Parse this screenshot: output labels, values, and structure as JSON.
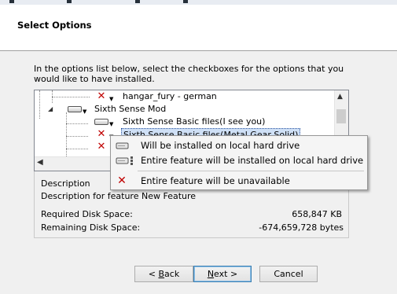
{
  "header": {
    "title": "Select Options"
  },
  "instructions": "In the options list below, select the checkboxes for the options that you would like to have installed.",
  "tree": {
    "rows": [
      {
        "label": "hangar_fury - german",
        "icon": "red-x-icon",
        "selected": false
      },
      {
        "label": "Sixth Sense Mod",
        "icon": "drive-icon",
        "selected": false,
        "expanded": true
      },
      {
        "label": "Sixth Sense Basic files(I see you)",
        "icon": "drive-icon",
        "selected": false
      },
      {
        "label": "Sixth Sense Basic files(Metal Gear Solid)",
        "icon": "red-x-icon",
        "selected": true
      },
      {
        "label": "",
        "icon": "red-x-icon",
        "selected": false
      }
    ]
  },
  "popup_menu": {
    "items": [
      {
        "label": "Will be installed on local hard drive",
        "icon": "drive-icon"
      },
      {
        "label": "Entire feature will be installed on local hard drive",
        "icon": "drive-tree-icon"
      },
      {
        "label": "Entire feature will be unavailable",
        "icon": "red-x-icon"
      }
    ]
  },
  "description": {
    "caption": "Description",
    "text": "Description for feature New Feature"
  },
  "disk": {
    "required_label": "Required Disk Space:",
    "required_value": "658,847 KB",
    "remaining_label": "Remaining Disk Space:",
    "remaining_value": "-674,659,728 bytes"
  },
  "buttons": {
    "back": {
      "prefix": "< ",
      "mnemonic": "B",
      "rest": "ack"
    },
    "next": {
      "mnemonic": "N",
      "rest": "ext >"
    },
    "cancel": "Cancel"
  },
  "colors": {
    "x_red": "#c00000",
    "selection": "#cfe0f6",
    "focus": "#3c7fb1"
  }
}
